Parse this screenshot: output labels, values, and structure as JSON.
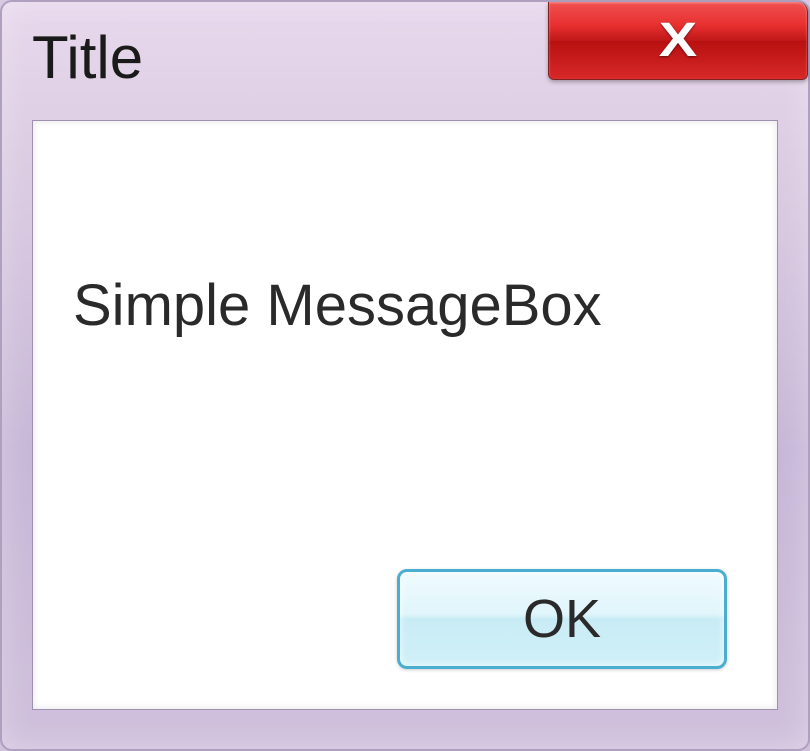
{
  "window": {
    "title": "Title",
    "close_label": "X"
  },
  "message": {
    "text": "Simple MessageBox"
  },
  "buttons": {
    "ok_label": "OK"
  }
}
